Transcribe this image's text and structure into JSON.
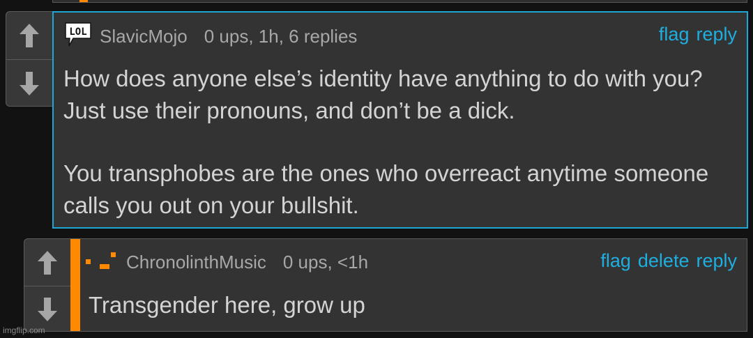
{
  "comment1": {
    "username": "SlavicMojo",
    "stats": "0 ups, 1h, 6 replies",
    "actions": {
      "flag": "flag",
      "reply": "reply"
    },
    "badge_text": "LOL",
    "body": [
      "How does anyone else’s identity have anything to do with you? Just use their pronouns, and don’t be a dick.",
      "You transphobes are the ones who overreact anytime someone calls you out on your bullshit."
    ]
  },
  "comment2": {
    "username": "ChronolinthMusic",
    "stats": "0 ups, <1h",
    "actions": {
      "flag": "flag",
      "delete": "delete",
      "reply": "reply"
    },
    "body": "Transgender here, grow up"
  },
  "watermark": "imgflip.com",
  "colors": {
    "accent_blue": "#1ea7d6",
    "accent_orange": "#ff8a00",
    "panel": "#333333",
    "background": "#121212"
  },
  "icons": [
    "up-arrow-icon",
    "down-arrow-icon",
    "lol-speech-bubble-icon",
    "pixel-avatar-icon"
  ]
}
